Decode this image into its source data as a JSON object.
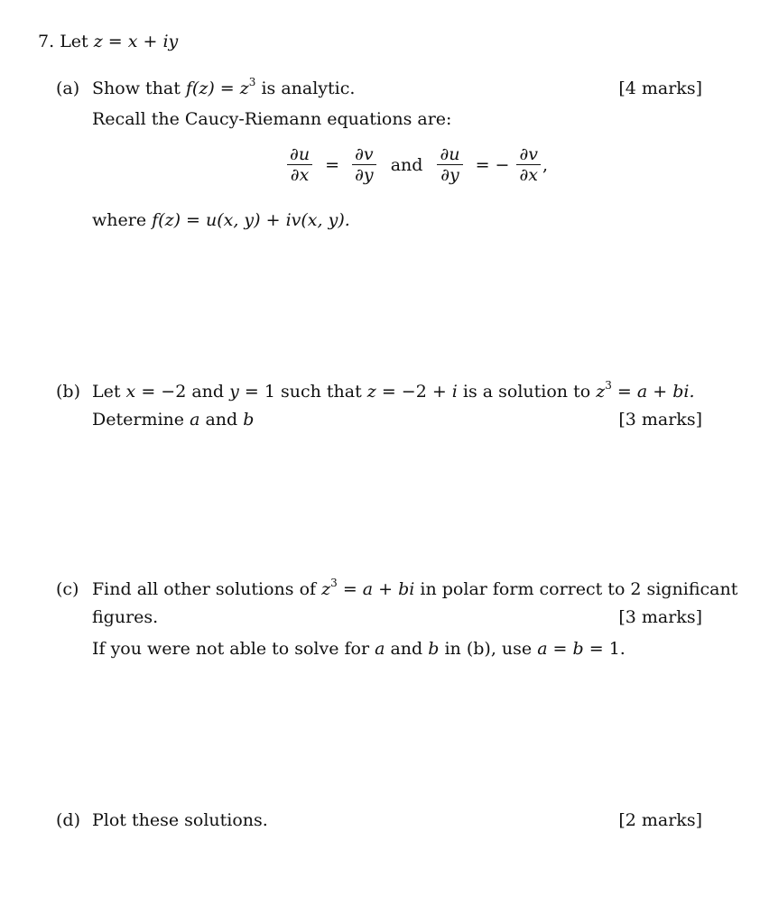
{
  "question": {
    "number": "7.",
    "intro_text": "Let",
    "intro_math": "z = x + iy"
  },
  "parts": {
    "a": {
      "label": "(a)",
      "text_before": "Show that",
      "math": "f(z) = z",
      "exponent": "3",
      "text_after": "is analytic.",
      "marks": "[4 marks]",
      "recall": "Recall the Caucy-Riemann equations are:",
      "eq1_lhs_num": "∂u",
      "eq1_lhs_den": "∂x",
      "eq1_rhs_num": "∂v",
      "eq1_rhs_den": "∂y",
      "and": "and",
      "eq2_lhs_num": "∂u",
      "eq2_lhs_den": "∂y",
      "eq2_rhs_num": "∂v",
      "eq2_rhs_den": "∂x",
      "equals": "=",
      "neg_equals": "= −",
      "comma": ",",
      "where_text": "where",
      "where_math": "f(z) = u(x, y) + iv(x, y)."
    },
    "b": {
      "label": "(b)",
      "line1_a": "Let",
      "line1_m1": "x",
      "line1_b": "= −2 and",
      "line1_m2": "y",
      "line1_c": "= 1 such that",
      "line1_m3": "z",
      "line1_d": "= −2 +",
      "line1_m4": "i",
      "line1_e": "is a solution to",
      "line1_m5": "z",
      "line1_exp": "3",
      "line1_f": "=",
      "line1_m6": "a + bi.",
      "line2_a": "Determine",
      "line2_m1": "a",
      "line2_b": "and",
      "line2_m2": "b",
      "marks": "[3 marks]"
    },
    "c": {
      "label": "(c)",
      "line1_a": "Find all other solutions of",
      "line1_m1": "z",
      "line1_exp": "3",
      "line1_b": "=",
      "line1_m2": "a + bi",
      "line1_c": "in polar form correct to 2 significant",
      "line2": "figures.",
      "marks": "[3 marks]",
      "line3_a": "If you were not able to solve for",
      "line3_m1": "a",
      "line3_b": "and",
      "line3_m2": "b",
      "line3_c": "in (b), use",
      "line3_m3": "a = b",
      "line3_d": "= 1."
    },
    "d": {
      "label": "(d)",
      "text": "Plot these solutions.",
      "marks": "[2 marks]"
    }
  }
}
